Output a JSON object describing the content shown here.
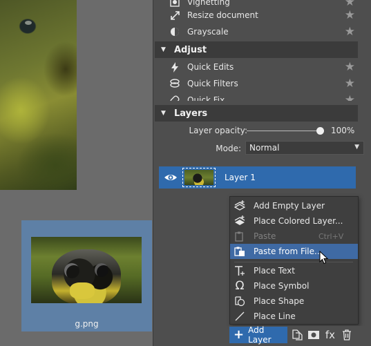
{
  "quick_fix_items_top": [
    {
      "label": "Vignetting",
      "icon": "vignette-icon"
    },
    {
      "label": "Resize document",
      "icon": "resize-icon"
    },
    {
      "label": "Grayscale",
      "icon": "grayscale-icon"
    }
  ],
  "adjust": {
    "title": "Adjust",
    "items": [
      {
        "label": "Quick Edits",
        "icon": "lightning-icon"
      },
      {
        "label": "Quick Filters",
        "icon": "filters-icon"
      },
      {
        "label": "Quick Fix",
        "icon": "bandage-icon"
      }
    ]
  },
  "layers": {
    "title": "Layers",
    "opacity_label": "Layer opacity:",
    "opacity_value": "100%",
    "opacity_fraction": 1.0,
    "mode_label": "Mode:",
    "mode_value": "Normal",
    "layer_name": "Layer 1"
  },
  "file_thumbnail": {
    "name": "g.png"
  },
  "context_menu": {
    "items": [
      {
        "label": "Add Empty Layer",
        "icon": "add-empty-layer-icon",
        "shortcut": ""
      },
      {
        "label": "Place Colored Layer...",
        "icon": "colored-layer-icon",
        "shortcut": ""
      },
      {
        "label": "Paste",
        "icon": "paste-icon",
        "shortcut": "Ctrl+V",
        "disabled": true
      },
      {
        "label": "Paste from File...",
        "icon": "paste-file-icon",
        "shortcut": "",
        "highlighted": true
      },
      {
        "label": "Place Text",
        "icon": "text-icon",
        "shortcut": ""
      },
      {
        "label": "Place Symbol",
        "icon": "omega-icon",
        "shortcut": ""
      },
      {
        "label": "Place Shape",
        "icon": "shape-icon",
        "shortcut": ""
      },
      {
        "label": "Place Line",
        "icon": "line-icon",
        "shortcut": ""
      }
    ]
  },
  "bottom_bar": {
    "add_layer_label": "Add Layer",
    "fx_label": "fx"
  },
  "colors": {
    "accent": "#2f6aad",
    "panel_bg": "#4e4e4e",
    "menu_highlight": "#3f6aa4"
  }
}
